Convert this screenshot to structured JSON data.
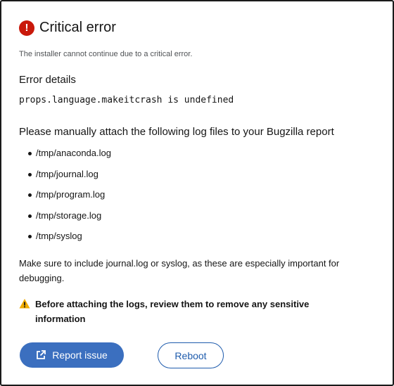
{
  "dialog": {
    "title": "Critical error",
    "title_icon": "exclamation-circle-icon",
    "description": "The installer cannot continue due to a critical error.",
    "details_heading": "Error details",
    "error_message": "props.language.makeitcrash is undefined",
    "logs_heading": "Please manually attach the following log files to your Bugzilla report",
    "log_files": [
      "/tmp/anaconda.log",
      "/tmp/journal.log",
      "/tmp/program.log",
      "/tmp/storage.log",
      "/tmp/syslog"
    ],
    "note": "Make sure to include journal.log or syslog, as these are especially important for debugging.",
    "warning_icon": "warning-triangle-icon",
    "warning": "Before attaching the logs, review them to remove any sensitive information"
  },
  "actions": {
    "report_label": "Report issue",
    "report_icon": "external-link-icon",
    "reboot_label": "Reboot"
  },
  "colors": {
    "danger": "#c9190b",
    "warning": "#f0ab00",
    "primary": "#3b6fbf",
    "link": "#1f5cad",
    "text": "#151515"
  }
}
